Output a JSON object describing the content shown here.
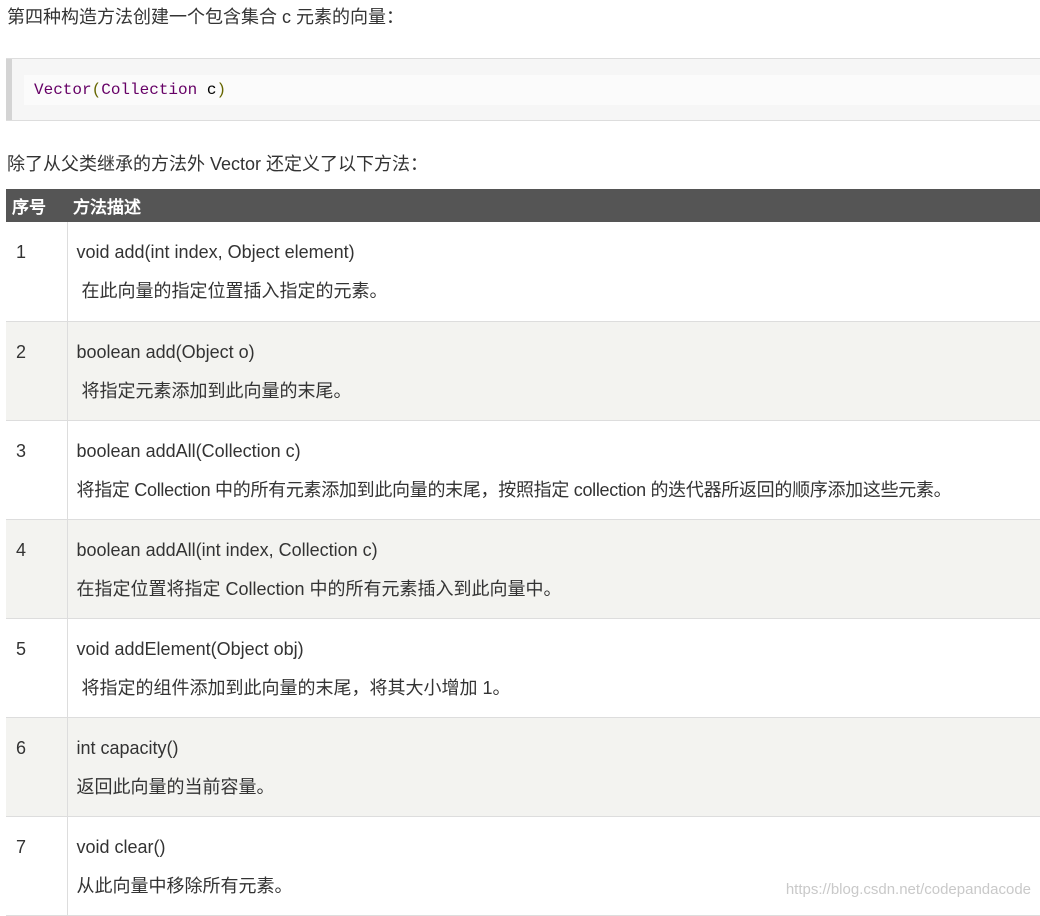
{
  "intro_text": "第四种构造方法创建一个包含集合 c 元素的向量：",
  "code": {
    "class_name": "Vector",
    "open_paren": "(",
    "param_type": "Collection",
    "param_name": " c",
    "close_paren": ")"
  },
  "lead_text": "除了从父类继承的方法外 Vector 还定义了以下方法：",
  "table": {
    "headers": [
      "序号",
      "方法描述"
    ],
    "rows": [
      {
        "num": "1",
        "signature": "void add(int index, Object element)",
        "description": "在此向量的指定位置插入指定的元素。"
      },
      {
        "num": "2",
        "signature": "boolean add(Object o)",
        "description": "将指定元素添加到此向量的末尾。"
      },
      {
        "num": "3",
        "signature": "boolean addAll(Collection c)",
        "description": "将指定 Collection 中的所有元素添加到此向量的末尾，按照指定 collection 的迭代器所返回的顺序添加这些元素。"
      },
      {
        "num": "4",
        "signature": "boolean addAll(int index, Collection c)",
        "description": "在指定位置将指定 Collection 中的所有元素插入到此向量中。"
      },
      {
        "num": "5",
        "signature": "void addElement(Object obj)",
        "description": "将指定的组件添加到此向量的末尾，将其大小增加 1。"
      },
      {
        "num": "6",
        "signature": "int capacity()",
        "description": "返回此向量的当前容量。"
      },
      {
        "num": "7",
        "signature": "void clear()",
        "description": "从此向量中移除所有元素。"
      }
    ]
  },
  "watermark": "https://blog.csdn.net/codepandacode"
}
